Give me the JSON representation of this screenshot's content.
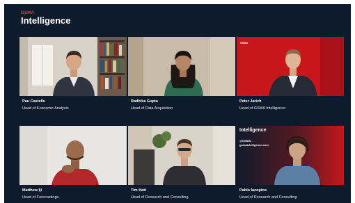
{
  "brand": {
    "top": "GSMA",
    "name": "Intelligence"
  },
  "participants": [
    {
      "name": "Pau Castells",
      "role": "Head of Economic Analysis"
    },
    {
      "name": "Radhika Gupta",
      "role": "Head of Data Acquisition"
    },
    {
      "name": "Peter Jarich",
      "role": "Head of GSMA Intelligence",
      "overlay": "GSMA"
    },
    {
      "name": "Matthew Iji",
      "role": "Head of Forecastings"
    },
    {
      "name": "Tim Hatt",
      "role": "Head of Research and Consulting"
    },
    {
      "name": "Pablo Iacopino",
      "role": "Head of Research and Consulting",
      "overlay": {
        "title": "Intelligence",
        "handle": "@GSMAi",
        "url": "gsmaintelligence.com"
      }
    }
  ],
  "colors": {
    "background": "#0d1b2c",
    "accent": "#e0413a",
    "tile_red": "#c8161d"
  }
}
